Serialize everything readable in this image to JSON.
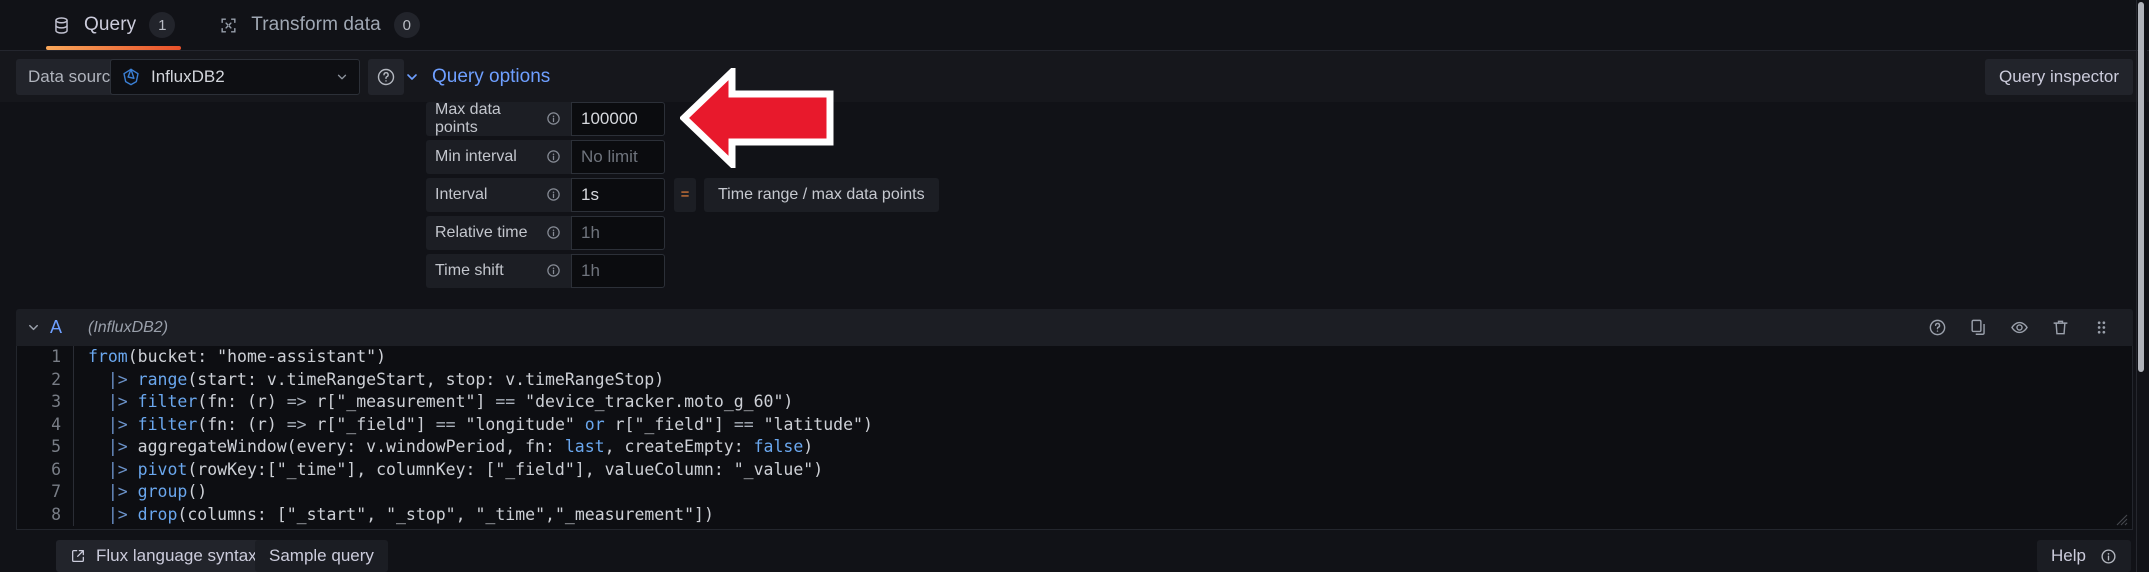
{
  "tabs": [
    {
      "label": "Query",
      "count": "1",
      "icon": "database-icon",
      "active": true
    },
    {
      "label": "Transform data",
      "count": "0",
      "icon": "transform-icon",
      "active": false
    }
  ],
  "datasource": {
    "label": "Data source",
    "selected": "InfluxDB2",
    "icon": "influxdb-icon",
    "help_icon": "help-circle-icon",
    "chevron_icon": "chevron-down-icon"
  },
  "query_inspector": {
    "label": "Query inspector"
  },
  "query_options": {
    "title": "Query options",
    "expanded": true,
    "chevron_icon": "chevron-down-icon",
    "rows": [
      {
        "label": "Max data points",
        "value": "100000",
        "placeholder": "",
        "is_placeholder": false,
        "info_icon": "info-circle-icon"
      },
      {
        "label": "Min interval",
        "value": "",
        "placeholder": "No limit",
        "is_placeholder": true,
        "info_icon": "info-circle-icon"
      },
      {
        "label": "Interval",
        "value": "1s",
        "placeholder": "",
        "is_placeholder": false,
        "info_icon": "info-circle-icon",
        "equals": "=",
        "formula": "Time range / max data points"
      },
      {
        "label": "Relative time",
        "value": "",
        "placeholder": "1h",
        "is_placeholder": true,
        "info_icon": "info-circle-icon"
      },
      {
        "label": "Time shift",
        "value": "",
        "placeholder": "1h",
        "is_placeholder": true,
        "info_icon": "info-circle-icon"
      }
    ]
  },
  "annotation": {
    "type": "arrow-left-annotation",
    "fill_color": "#e8192c",
    "stroke_color": "#ffffff",
    "points_at": "Max data points"
  },
  "query_row": {
    "refid": "A",
    "datasource_note": "(InfluxDB2)",
    "chevron_icon": "chevron-down-icon",
    "actions": [
      {
        "name": "help-icon",
        "glyph": "?"
      },
      {
        "name": "duplicate-query-icon",
        "glyph": "copy"
      },
      {
        "name": "hide-response-icon",
        "glyph": "eye"
      },
      {
        "name": "remove-query-icon",
        "glyph": "trash"
      },
      {
        "name": "drag-handle-icon",
        "glyph": "dots"
      }
    ]
  },
  "editor": {
    "language": "flux",
    "lines": [
      {
        "n": "1",
        "text": "from(bucket: \"home-assistant\")"
      },
      {
        "n": "2",
        "text": "  |> range(start: v.timeRangeStart, stop: v.timeRangeStop)"
      },
      {
        "n": "3",
        "text": "  |> filter(fn: (r) => r[\"_measurement\"] == \"device_tracker.moto_g_60\")"
      },
      {
        "n": "4",
        "text": "  |> filter(fn: (r) => r[\"_field\"] == \"longitude\" or r[\"_field\"] == \"latitude\")"
      },
      {
        "n": "5",
        "text": "  |> aggregateWindow(every: v.windowPeriod, fn: last, createEmpty: false)"
      },
      {
        "n": "6",
        "text": "  |> pivot(rowKey:[\"_time\"], columnKey: [\"_field\"], valueColumn: \"_value\")"
      },
      {
        "n": "7",
        "text": "  |> group()"
      },
      {
        "n": "8",
        "text": "  |> drop(columns: [\"_start\", \"_stop\", \"_time\",\"_measurement\"])"
      }
    ]
  },
  "bottom_bar": {
    "flux_syntax": {
      "label": "Flux language syntax",
      "icon": "external-link-icon"
    },
    "sample_query": {
      "label": "Sample query"
    },
    "help": {
      "label": "Help",
      "icon": "info-circle-icon"
    }
  },
  "colors": {
    "accent_orange": "#e8502a",
    "link_blue": "#6e9fff",
    "background": "#111217",
    "panel": "#16171c",
    "annotation_red": "#e8192c"
  }
}
